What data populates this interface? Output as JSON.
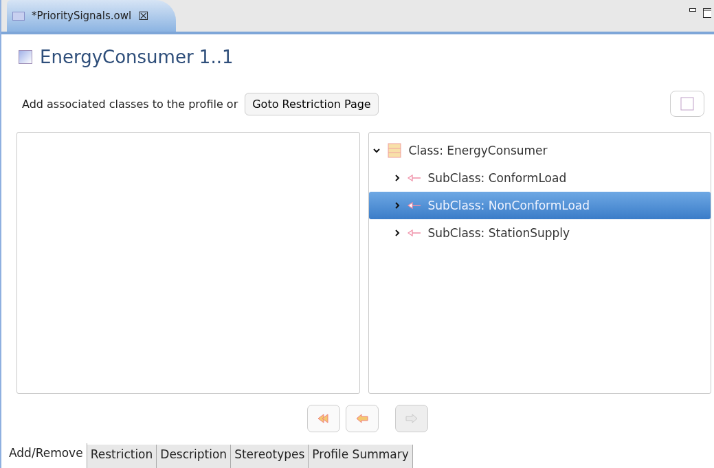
{
  "editor_tab": {
    "title": "*PrioritySignals.owl",
    "close": "☒"
  },
  "header": {
    "title": "EnergyConsumer 1..1"
  },
  "toolbar": {
    "text": "Add associated classes to the profile or",
    "button": "Goto Restriction Page"
  },
  "tree": [
    {
      "label": "Class: EnergyConsumer",
      "kind": "class",
      "expanded": true,
      "selected": false,
      "children": [
        {
          "label": "SubClass: ConformLoad",
          "kind": "subclass",
          "expanded": false,
          "selected": false
        },
        {
          "label": "SubClass: NonConformLoad",
          "kind": "subclass",
          "expanded": false,
          "selected": true
        },
        {
          "label": "SubClass: StationSupply",
          "kind": "subclass",
          "expanded": false,
          "selected": false
        }
      ]
    }
  ],
  "move_buttons": [
    {
      "kind": "remove-all",
      "disabled": false
    },
    {
      "kind": "remove",
      "disabled": false
    },
    {
      "kind": "add",
      "disabled": true
    }
  ],
  "page_tabs": [
    {
      "label": "Add/Remove",
      "selected": true
    },
    {
      "label": "Restriction",
      "selected": false
    },
    {
      "label": "Description",
      "selected": false
    },
    {
      "label": "Stereotypes",
      "selected": false
    },
    {
      "label": "Profile Summary",
      "selected": false
    }
  ]
}
